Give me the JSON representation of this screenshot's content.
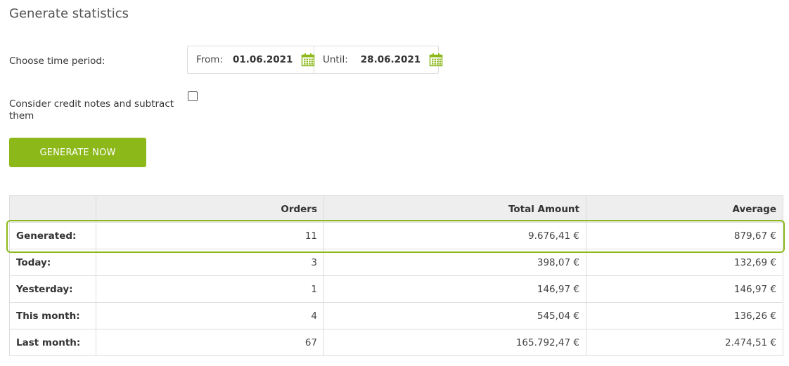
{
  "page": {
    "title": "Generate statistics",
    "period_label": "Choose time period:",
    "from_label": "From:",
    "from_value": "01.06.2021",
    "until_label": "Until:",
    "until_value": "28.06.2021",
    "credit_label": "Consider credit notes and subtract them",
    "credit_checked": false,
    "generate_label": "GENERATE NOW"
  },
  "icons": {
    "from_calendar": "calendar-icon",
    "until_calendar": "calendar-icon"
  },
  "colors": {
    "accent": "#8cb81a",
    "header_bg": "#eeeeee",
    "border": "#dddddd"
  },
  "table": {
    "headers": [
      "",
      "Orders",
      "Total Amount",
      "Average"
    ],
    "rows": [
      {
        "label": "Generated:",
        "orders": "11",
        "total": "9.676,41 €",
        "average": "879,67 €",
        "highlighted": true
      },
      {
        "label": "Today:",
        "orders": "3",
        "total": "398,07 €",
        "average": "132,69 €"
      },
      {
        "label": "Yesterday:",
        "orders": "1",
        "total": "146,97 €",
        "average": "146,97 €"
      },
      {
        "label": "This month:",
        "orders": "4",
        "total": "545,04 €",
        "average": "136,26 €"
      },
      {
        "label": "Last month:",
        "orders": "67",
        "total": "165.792,47 €",
        "average": "2.474,51 €"
      }
    ]
  }
}
